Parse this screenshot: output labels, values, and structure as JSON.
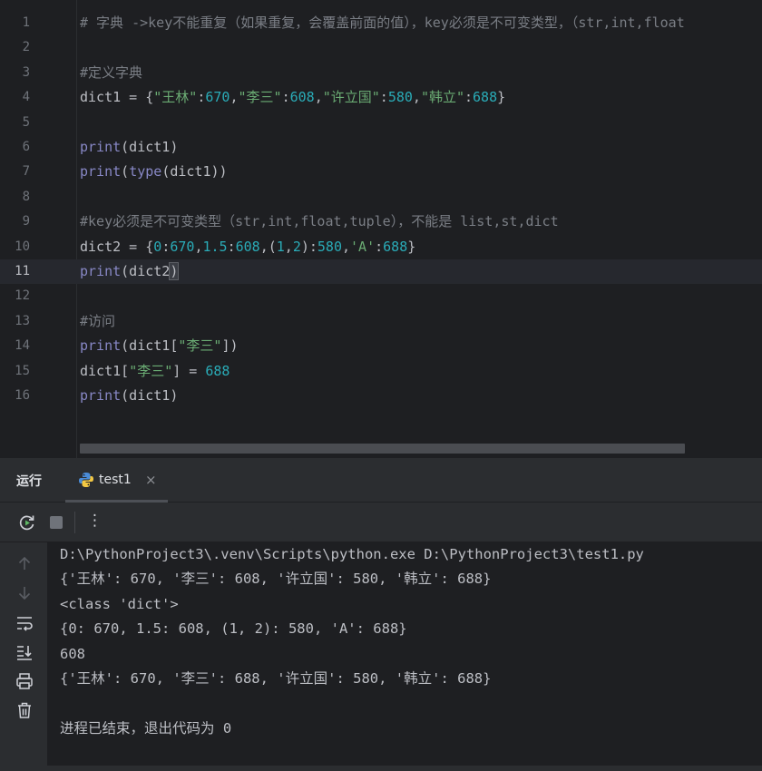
{
  "editor": {
    "lines": [
      {
        "num": "1",
        "tokens": [
          {
            "t": "comment",
            "v": "# 字典 ->key不能重复（如果重复，会覆盖前面的值），key必须是不可变类型，（str,int,float"
          }
        ]
      },
      {
        "num": "2",
        "tokens": []
      },
      {
        "num": "3",
        "tokens": [
          {
            "t": "comment",
            "v": "#定义字典"
          }
        ]
      },
      {
        "num": "4",
        "tokens": [
          {
            "t": "plain",
            "v": "dict1 = {"
          },
          {
            "t": "str",
            "v": "\"王林\""
          },
          {
            "t": "plain",
            "v": ":"
          },
          {
            "t": "num",
            "v": "670"
          },
          {
            "t": "plain",
            "v": ","
          },
          {
            "t": "str",
            "v": "\"李三\""
          },
          {
            "t": "plain",
            "v": ":"
          },
          {
            "t": "num",
            "v": "608"
          },
          {
            "t": "plain",
            "v": ","
          },
          {
            "t": "str",
            "v": "\"许立国\""
          },
          {
            "t": "plain",
            "v": ":"
          },
          {
            "t": "num",
            "v": "580"
          },
          {
            "t": "plain",
            "v": ","
          },
          {
            "t": "str",
            "v": "\"韩立\""
          },
          {
            "t": "plain",
            "v": ":"
          },
          {
            "t": "num",
            "v": "688"
          },
          {
            "t": "plain",
            "v": "}"
          }
        ]
      },
      {
        "num": "5",
        "tokens": []
      },
      {
        "num": "6",
        "tokens": [
          {
            "t": "kw",
            "v": "print"
          },
          {
            "t": "plain",
            "v": "(dict1)"
          }
        ]
      },
      {
        "num": "7",
        "tokens": [
          {
            "t": "kw",
            "v": "print"
          },
          {
            "t": "plain",
            "v": "("
          },
          {
            "t": "kw",
            "v": "type"
          },
          {
            "t": "plain",
            "v": "(dict1))"
          }
        ]
      },
      {
        "num": "8",
        "tokens": []
      },
      {
        "num": "9",
        "tokens": [
          {
            "t": "comment",
            "v": "#key必须是不可变类型（str,int,float,tuple），不能是 list,st,dict"
          }
        ]
      },
      {
        "num": "10",
        "tokens": [
          {
            "t": "plain",
            "v": "dict2 = {"
          },
          {
            "t": "num",
            "v": "0"
          },
          {
            "t": "plain",
            "v": ":"
          },
          {
            "t": "num",
            "v": "670"
          },
          {
            "t": "plain",
            "v": ","
          },
          {
            "t": "num",
            "v": "1.5"
          },
          {
            "t": "plain",
            "v": ":"
          },
          {
            "t": "num",
            "v": "608"
          },
          {
            "t": "plain",
            "v": ",("
          },
          {
            "t": "num",
            "v": "1"
          },
          {
            "t": "plain",
            "v": ","
          },
          {
            "t": "num",
            "v": "2"
          },
          {
            "t": "plain",
            "v": "):"
          },
          {
            "t": "num",
            "v": "580"
          },
          {
            "t": "plain",
            "v": ","
          },
          {
            "t": "str",
            "v": "'A'"
          },
          {
            "t": "plain",
            "v": ":"
          },
          {
            "t": "num",
            "v": "688"
          },
          {
            "t": "plain",
            "v": "}"
          }
        ]
      },
      {
        "num": "11",
        "current": true,
        "tokens": [
          {
            "t": "kw",
            "v": "print"
          },
          {
            "t": "plain",
            "v": "(dict2"
          },
          {
            "t": "bracket",
            "v": ")"
          }
        ]
      },
      {
        "num": "12",
        "tokens": []
      },
      {
        "num": "13",
        "tokens": [
          {
            "t": "comment",
            "v": "#访问"
          }
        ]
      },
      {
        "num": "14",
        "tokens": [
          {
            "t": "kw",
            "v": "print"
          },
          {
            "t": "plain",
            "v": "(dict1["
          },
          {
            "t": "str",
            "v": "\"李三\""
          },
          {
            "t": "plain",
            "v": "])"
          }
        ]
      },
      {
        "num": "15",
        "tokens": [
          {
            "t": "plain",
            "v": "dict1["
          },
          {
            "t": "str",
            "v": "\"李三\""
          },
          {
            "t": "plain",
            "v": "] = "
          },
          {
            "t": "num",
            "v": "688"
          }
        ]
      },
      {
        "num": "16",
        "tokens": [
          {
            "t": "kw",
            "v": "print"
          },
          {
            "t": "plain",
            "v": "(dict1)"
          }
        ]
      }
    ]
  },
  "run_panel": {
    "title": "运行",
    "tab_label": "test1",
    "tab_close": "×",
    "toolbar": {
      "rerun_icon": "rerun-icon",
      "stop_icon": "stop-icon",
      "more_icon": "more-vertical-icon",
      "more_glyph": "⋮"
    },
    "side_icons": [
      "arrow-up-icon",
      "arrow-down-icon",
      "soft-wrap-icon",
      "scroll-to-end-icon",
      "print-icon",
      "trash-icon"
    ],
    "output": [
      "D:\\PythonProject3\\.venv\\Scripts\\python.exe D:\\PythonProject3\\test1.py",
      "{'王林': 670, '李三': 608, '许立国': 580, '韩立': 688}",
      "<class 'dict'>",
      "{0: 670, 1.5: 608, (1, 2): 580, 'A': 688}",
      "608",
      "{'王林': 670, '李三': 688, '许立国': 580, '韩立': 688}",
      "",
      "进程已结束，退出代码为 0"
    ]
  },
  "colors": {
    "background": "#1e1f22",
    "panel": "#2b2d30",
    "comment": "#7a7e85",
    "string": "#6aab73",
    "number": "#2aacb8",
    "builtin": "#8888c6",
    "text": "#bcbec4"
  }
}
